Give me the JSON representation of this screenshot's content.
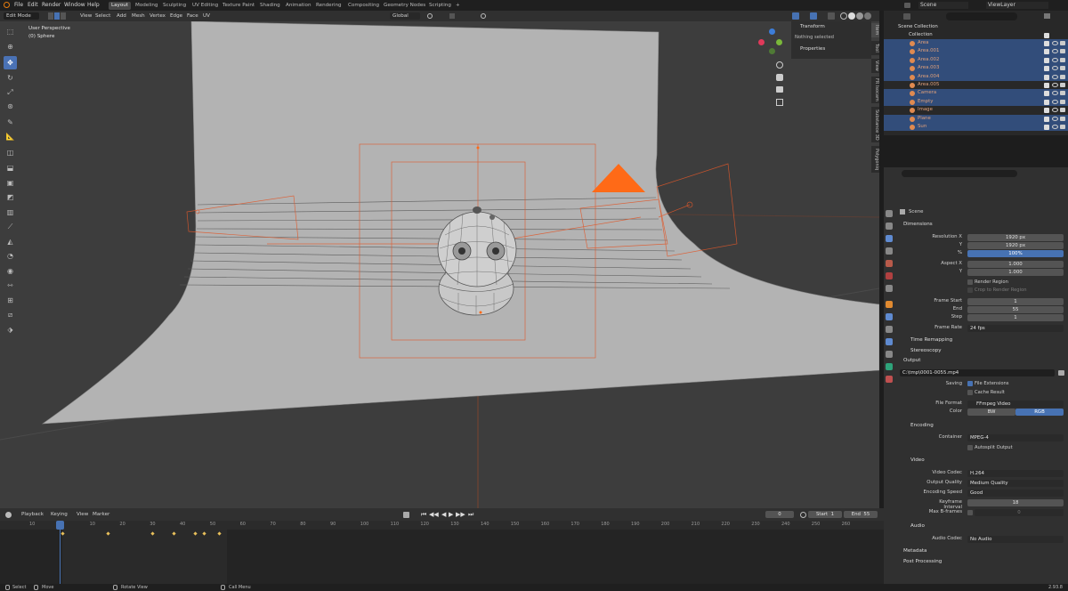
{
  "topbar": {
    "menus": [
      "File",
      "Edit",
      "Render",
      "Window",
      "Help"
    ],
    "workspaces": [
      "Layout",
      "Modeling",
      "Sculpting",
      "UV Editing",
      "Texture Paint",
      "Shading",
      "Animation",
      "Rendering",
      "Compositing",
      "Geometry Nodes",
      "Scripting",
      "+"
    ],
    "active_workspace": "Layout",
    "scene_label": "Scene",
    "viewlayer_label": "ViewLayer"
  },
  "viewport_header": {
    "mode": "Edit Mode",
    "menus": [
      "View",
      "Select",
      "Add",
      "Mesh",
      "Vertex",
      "Edge",
      "Face",
      "UV"
    ],
    "orientation": "Global"
  },
  "viewport": {
    "view_name": "User Perspective",
    "object_name": "(0) Sphere"
  },
  "npanel": {
    "tabs": [
      "Item",
      "Tool",
      "View",
      "FR Isocam",
      "Substance 3D",
      "Polygoniq"
    ],
    "transform_label": "Transform",
    "transform_value": "Nothing selected",
    "properties_label": "Properties"
  },
  "outliner": {
    "title": "Scene Collection",
    "collection": "Collection",
    "items": [
      {
        "name": "Area",
        "selected": true
      },
      {
        "name": "Area.001",
        "selected": true
      },
      {
        "name": "Area.002",
        "selected": true
      },
      {
        "name": "Area.003",
        "selected": true
      },
      {
        "name": "Area.004",
        "selected": true
      },
      {
        "name": "Area.005",
        "selected": false
      },
      {
        "name": "Camera",
        "selected": true
      },
      {
        "name": "Empty",
        "selected": true
      },
      {
        "name": "Image",
        "selected": false
      },
      {
        "name": "Plane",
        "selected": true
      },
      {
        "name": "Sun",
        "selected": true
      }
    ]
  },
  "properties": {
    "scene_label": "Scene",
    "dimensions": "Dimensions",
    "resolution_x_label": "Resolution X",
    "resolution_x": "1920 px",
    "y_label": "Y",
    "resolution_y": "1920 px",
    "pct_label": "%",
    "resolution_pct": "100%",
    "aspect_x_label": "Aspect X",
    "aspect_x": "1.000",
    "aspect_y": "1.000",
    "render_region": "Render Region",
    "crop_region": "Crop to Render Region",
    "frame_start_label": "Frame Start",
    "frame_start": "1",
    "end_label": "End",
    "frame_end": "55",
    "step_label": "Step",
    "frame_step": "1",
    "frame_rate_label": "Frame Rate",
    "frame_rate": "24 fps",
    "time_remapping": "Time Remapping",
    "stereoscopy": "Stereoscopy",
    "output": "Output",
    "output_path": "C:\\tmp\\0001-0055.mp4",
    "saving_label": "Saving",
    "file_extensions": "File Extensions",
    "cache_result": "Cache Result",
    "file_format_label": "File Format",
    "file_format": "FFmpeg Video",
    "color_label": "Color",
    "color_bw": "BW",
    "color_rgb": "RGB",
    "encoding": "Encoding",
    "container_label": "Container",
    "container": "MPEG-4",
    "autosplit": "Autosplit Output",
    "video": "Video",
    "video_codec_label": "Video Codec",
    "video_codec": "H.264",
    "output_quality_label": "Output Quality",
    "output_quality": "Medium Quality",
    "encoding_speed_label": "Encoding Speed",
    "encoding_speed": "Good",
    "keyframe_interval_label": "Keyframe Interval",
    "keyframe_interval": "18",
    "max_bframes_label": "Max B-frames",
    "max_bframes": "0",
    "audio": "Audio",
    "audio_codec_label": "Audio Codec",
    "audio_codec": "No Audio",
    "metadata": "Metadata",
    "post_processing": "Post Processing"
  },
  "timeline": {
    "playback": "Playback",
    "keying": "Keying",
    "view": "View",
    "marker": "Marker",
    "current_frame": "0",
    "start_label": "Start",
    "start": "1",
    "end_label": "End",
    "end": "55",
    "ticks": [
      "10",
      "0",
      "10",
      "20",
      "30",
      "40",
      "50",
      "60",
      "70",
      "80",
      "90",
      "100",
      "110",
      "120",
      "130",
      "140",
      "150",
      "160",
      "170",
      "180",
      "190",
      "200",
      "210",
      "220",
      "230",
      "240",
      "250",
      "260"
    ],
    "keyframes": [
      0,
      15,
      30,
      37,
      44,
      47,
      52
    ]
  },
  "statusbar": {
    "select": "Select",
    "move": "Move",
    "rotate": "Rotate View",
    "call_menu": "Call Menu",
    "version": "2.93.8"
  },
  "colors": {
    "accent": "#4772b3",
    "selection_orange": "#ff6a17",
    "outliner_sel": "#324d7a"
  }
}
